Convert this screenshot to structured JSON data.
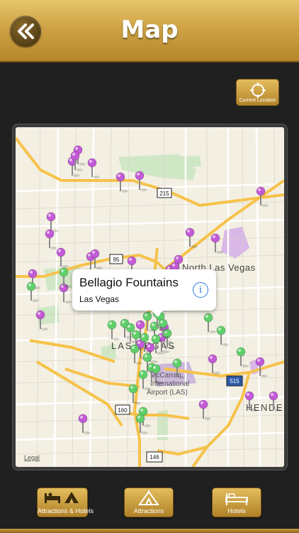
{
  "header": {
    "title": "Map",
    "back_icon": "double-chevron-left-icon"
  },
  "location_button": {
    "label": "Current Location",
    "icon": "crosshair-icon"
  },
  "map": {
    "labels": {
      "north_las_vegas": "North Las Vegas",
      "las_vegas": "LAS VEGAS",
      "henderson": "HENDER",
      "airport": "McCarran International Airport (LAS)",
      "airport_line1": "McCarran",
      "airport_line2": "International",
      "airport_line3": "Airport (LAS)"
    },
    "shields": [
      "215",
      "95",
      "515",
      "160",
      "146"
    ],
    "legal": "Legal",
    "colors": {
      "attraction_pin": "#c35ad8",
      "hotel_pin": "#5fd06a",
      "road": "#f6c24a",
      "park": "#cfe7c4"
    }
  },
  "callout": {
    "title": "Bellagio Fountains",
    "subtitle": "Las Vegas",
    "info_icon": "i"
  },
  "tabs": [
    {
      "label": "Attractions & Hotels",
      "icon": "bed-and-tent-icon"
    },
    {
      "label": "Attractions",
      "icon": "tent-icon"
    },
    {
      "label": "Hotels",
      "icon": "bed-icon"
    }
  ]
}
